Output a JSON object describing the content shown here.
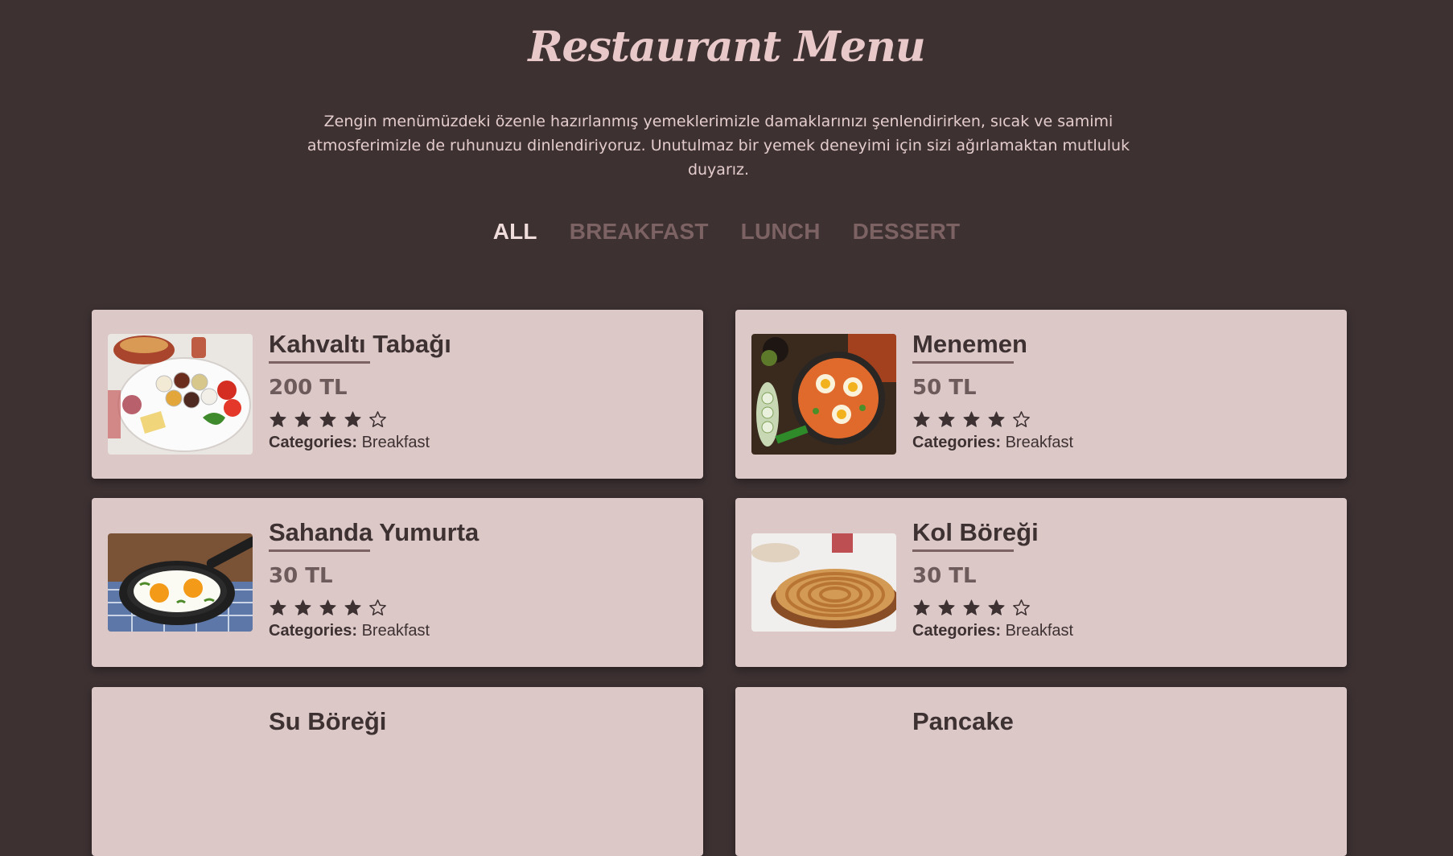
{
  "header": {
    "title": "Restaurant Menu",
    "intro": "Zengin menümüzdeki özenle hazırlanmış yemeklerimizle damaklarınızı şenlendirirken, sıcak ve samimi atmosferimizle de ruhunuzu dinlendiriyoruz. Unutulmaz bir yemek deneyimi için sizi ağırlamaktan mutluluk duyarız."
  },
  "filters": [
    {
      "label": "ALL",
      "active": true
    },
    {
      "label": "BREAKFAST",
      "active": false
    },
    {
      "label": "LUNCH",
      "active": false
    },
    {
      "label": "DESSERT",
      "active": false
    }
  ],
  "items": [
    {
      "name": "Kahvaltı Tabağı",
      "price": "200 TL",
      "rating": 4,
      "rating_max": 5,
      "categories_label": "Categories:",
      "category": "Breakfast",
      "image": "breakfast-platter"
    },
    {
      "name": "Menemen",
      "price": "50 TL",
      "rating": 4,
      "rating_max": 5,
      "categories_label": "Categories:",
      "category": "Breakfast",
      "image": "menemen-pan"
    },
    {
      "name": "Sahanda Yumurta",
      "price": "30 TL",
      "rating": 4,
      "rating_max": 5,
      "categories_label": "Categories:",
      "category": "Breakfast",
      "image": "fried-eggs-skillet"
    },
    {
      "name": "Kol Böreği",
      "price": "30 TL",
      "rating": 4,
      "rating_max": 5,
      "categories_label": "Categories:",
      "category": "Breakfast",
      "image": "spiral-borek"
    },
    {
      "name": "Su Böreği",
      "image": "su-boregi"
    },
    {
      "name": "Pancake",
      "image": "pancake"
    }
  ],
  "colors": {
    "background": "#3d3132",
    "card": "#ddc8c8",
    "accent": "#7c6263",
    "active_filter": "#f1dcdc",
    "star": "#3d3132"
  }
}
